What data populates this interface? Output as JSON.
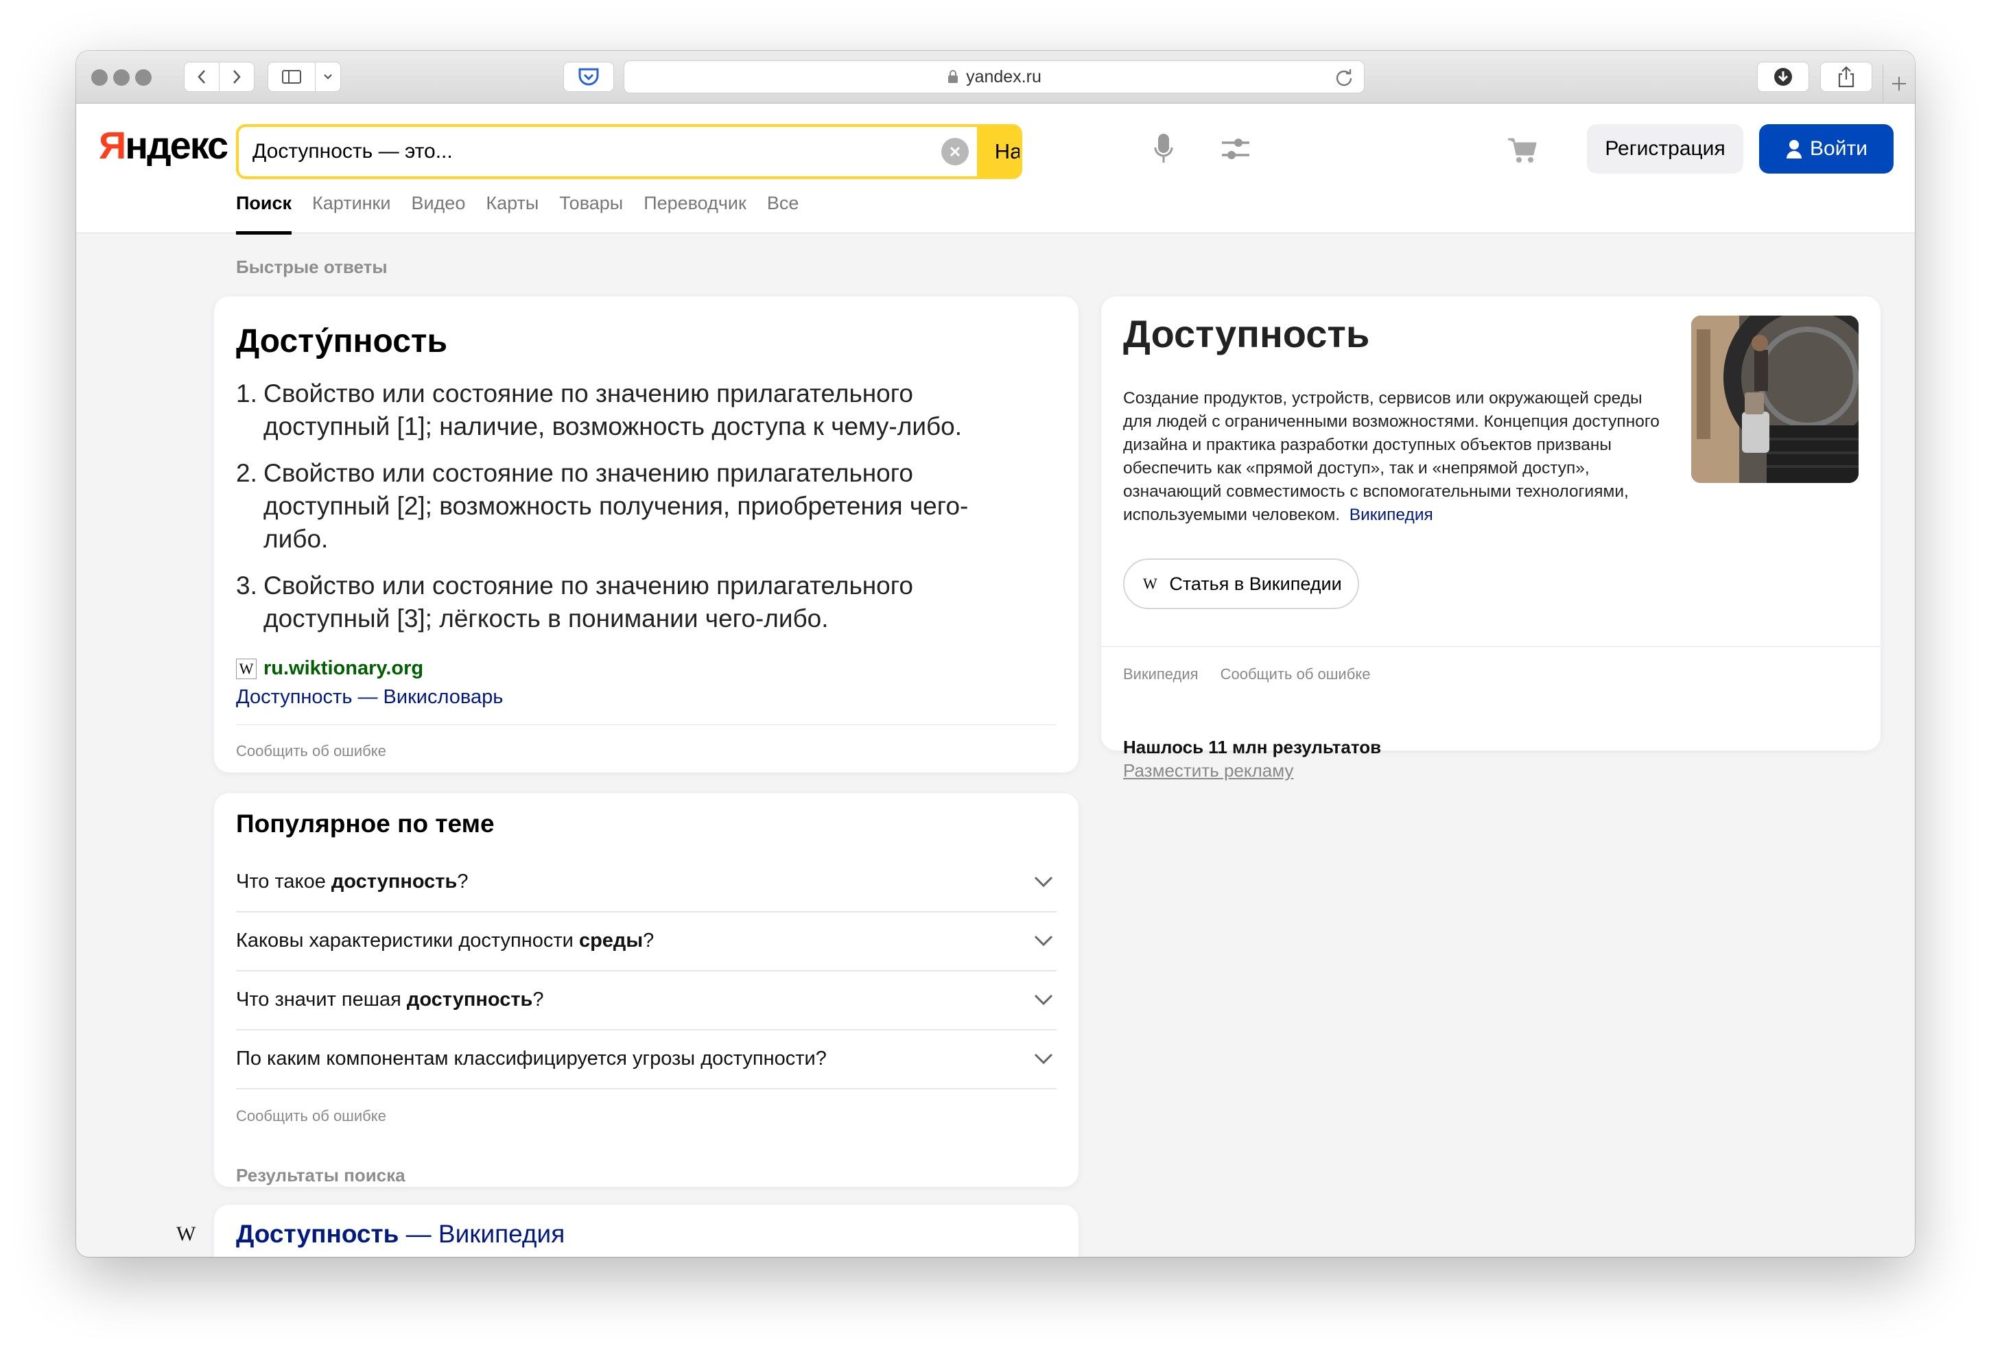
{
  "browser": {
    "url": "yandex.ru"
  },
  "header": {
    "logo_first": "Я",
    "logo_rest": "ндекс",
    "search_value": "Доступность — это...",
    "search_button": "Найти",
    "register_button": "Регистрация",
    "login_button": "Войти"
  },
  "nav": {
    "tabs": [
      {
        "label": "Поиск",
        "active": true
      },
      {
        "label": "Картинки",
        "active": false
      },
      {
        "label": "Видео",
        "active": false
      },
      {
        "label": "Карты",
        "active": false
      },
      {
        "label": "Товары",
        "active": false
      },
      {
        "label": "Переводчик",
        "active": false
      },
      {
        "label": "Все",
        "active": false
      }
    ]
  },
  "quick_answers": {
    "label": "Быстрые ответы",
    "title": "Досту́пность",
    "definitions": [
      {
        "num": "1.",
        "text": "Свойство или состояние по значению прилагательного доступный [1]; наличие, возможность доступа к чему-либо."
      },
      {
        "num": "2.",
        "text": "Свойство или состояние по значению прилагательного доступный [2]; возможность получения, приобретения чего-либо."
      },
      {
        "num": "3.",
        "text": "Свойство или состояние по значению прилагательного доступный [3]; лёгкость в понимании чего-либо."
      }
    ],
    "source_icon": "W",
    "source_domain": "ru.wiktionary.org",
    "source_link": "Доступность — Викисловарь",
    "report": "Сообщить об ошибке"
  },
  "popular": {
    "title": "Популярное по теме",
    "questions": [
      {
        "before": "Что такое ",
        "bold": "доступность",
        "after": "?"
      },
      {
        "before": "Каковы характеристики доступности ",
        "bold": "среды",
        "after": "?"
      },
      {
        "before": "Что значит пешая ",
        "bold": "доступность",
        "after": "?"
      },
      {
        "before": "По каким компонентам классифицируется угрозы доступности?",
        "bold": "",
        "after": ""
      }
    ],
    "report": "Сообщить об ошибке"
  },
  "results": {
    "label": "Результаты поиска",
    "first_bold": "Доступность",
    "first_rest": " — Википедия",
    "icon": "W"
  },
  "entity": {
    "title": "Доступность",
    "description": "Создание продуктов, устройств, сервисов или окружающей среды для людей с ограниченными возможностями. Концепция доступного дизайна и практика разработки доступных объектов призваны обеспечить как «прямой доступ», так и «непрямой доступ», означающий совместимость с вспомогательными технологиями, используемыми человеком.",
    "wiki_link": "Википедия",
    "wiki_button_icon": "W",
    "wiki_button": "Статья в Википедии",
    "footer_source": "Википедия",
    "footer_report": "Сообщить об ошибке"
  },
  "stats": {
    "found": "Нашлось 11 млн результатов",
    "advertise": "Разместить рекламу"
  },
  "colors": {
    "accent_yellow": "#fed42b",
    "login_blue": "#0047bb",
    "link_blue": "#001a80",
    "source_green": "#006000",
    "logo_red": "#fc3f1d"
  }
}
